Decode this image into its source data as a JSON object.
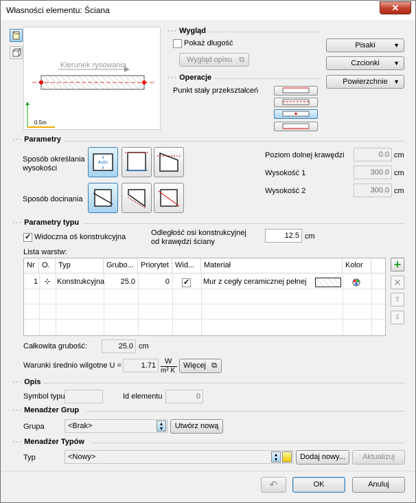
{
  "window": {
    "title": "Własności elementu: Ściana",
    "close": "✕"
  },
  "preview": {
    "direction_label": "Kierunek rysowania",
    "scale_label": "0.5m"
  },
  "wyglad": {
    "header": "Wygląd",
    "show_length": "Pokaż długość",
    "show_length_checked": false,
    "desc_button": "Wygląd opisu"
  },
  "right_buttons": {
    "pens": "Pisaki",
    "fonts": "Czcionki",
    "surfaces": "Powierzchnie"
  },
  "operacje": {
    "header": "Operacje",
    "label": "Punkt stały przekształceń"
  },
  "parametry": {
    "header": "Parametry",
    "height_method": "Sposób określania wysokości",
    "trim_method": "Sposób docinania",
    "bottom_edge_label": "Poziom dolnej krawędzi",
    "bottom_edge_value": "0.0",
    "height1_label": "Wysokość 1",
    "height1_value": "300.0",
    "height2_label": "Wysokość 2",
    "height2_value": "300.0",
    "unit": "cm",
    "icon_text": "Auto"
  },
  "parametry_typu": {
    "header": "Parametry typu",
    "axis_visible": "Widoczna oś konstrukcyjna",
    "axis_visible_checked": true,
    "axis_offset_label_1": "Odległość osi konstrukcyjnej",
    "axis_offset_label_2": "od krawędzi ściany",
    "axis_offset_value": "12.5",
    "unit": "cm",
    "layers_label": "Lista warstw:",
    "columns": [
      "Nr",
      "O.",
      "Typ",
      "Grubo...",
      "Priorytet",
      "Wid...",
      "Materiał",
      "Kolor"
    ],
    "rows": [
      {
        "nr": "1",
        "o": "⊹",
        "typ": "Konstrukcyjna",
        "grubosc": "25.0",
        "priorytet": "0",
        "widoczna": true,
        "material": "Mur z cegły ceramicznej pełnej"
      }
    ],
    "total_label": "Całkowita grubość:",
    "total_value": "25.0",
    "conditions_label": "Warunki średnio wilgotne U =",
    "u_value": "1.71",
    "u_unit_top": "W",
    "u_unit_bottom": "m² K",
    "more_button": "Więcej"
  },
  "opis": {
    "header": "Opis",
    "symbol_label": "Symbol typu",
    "symbol_value": "",
    "id_label": "Id elementu",
    "id_value": "0"
  },
  "menadzer_grup": {
    "header": "Menadżer Grup",
    "group_label": "Grupa",
    "group_value": "<Brak>",
    "create_button": "Utwórz nową"
  },
  "menadzer_typow": {
    "header": "Menadżer Typów",
    "type_label": "Typ",
    "type_value": "<Nowy>",
    "add_button": "Dodaj nowy...",
    "update_button": "Aktualizuj"
  },
  "footer": {
    "ok": "OK",
    "cancel": "Anuluj"
  },
  "colors": {
    "accent": "#3c7fb1",
    "close": "#c5442f",
    "add_green": "#2ea02e"
  }
}
